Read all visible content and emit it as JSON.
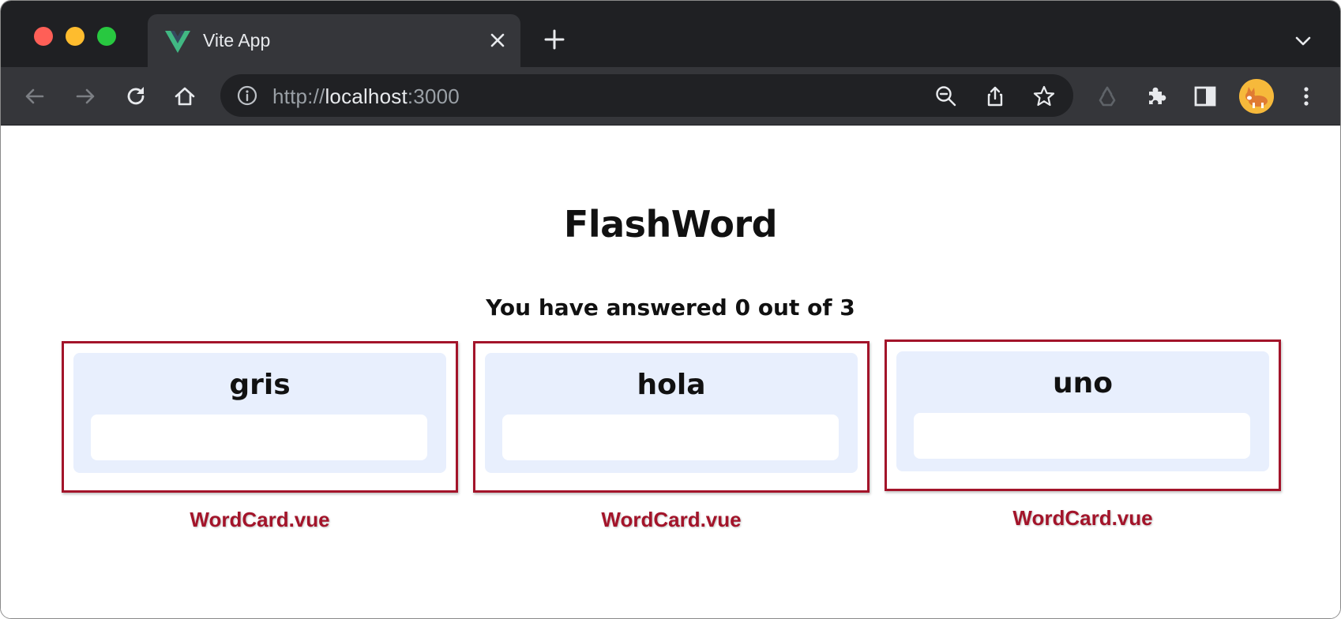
{
  "browser": {
    "tab": {
      "title": "Vite App",
      "favicon": "vue-logo-icon"
    },
    "url": {
      "scheme": "http://",
      "host": "localhost",
      "port": ":3000"
    },
    "icons": {
      "back": "back-arrow-icon",
      "forward": "forward-arrow-icon",
      "reload": "reload-icon",
      "home": "home-icon",
      "info": "info-icon",
      "zoom": "zoom-out-icon",
      "share": "share-icon",
      "bookmark": "star-icon",
      "recycle": "recycle-icon",
      "extensions": "puzzle-icon",
      "sidepanel": "side-panel-icon",
      "menu": "kebab-menu-icon",
      "profile": "avatar"
    },
    "colors": {
      "tabstrip": "#1f2023",
      "toolbar": "#35363a",
      "omnibox": "#202124"
    }
  },
  "app": {
    "title": "FlashWord",
    "progress_text": "You have answered 0 out of 3",
    "cards": [
      {
        "word": "gris",
        "input_value": "",
        "component_label": "WordCard.vue"
      },
      {
        "word": "hola",
        "input_value": "",
        "component_label": "WordCard.vue"
      },
      {
        "word": "uno",
        "input_value": "",
        "component_label": "WordCard.vue"
      }
    ],
    "colors": {
      "card_background": "#e8effd",
      "annotation": "#a3142a"
    }
  }
}
